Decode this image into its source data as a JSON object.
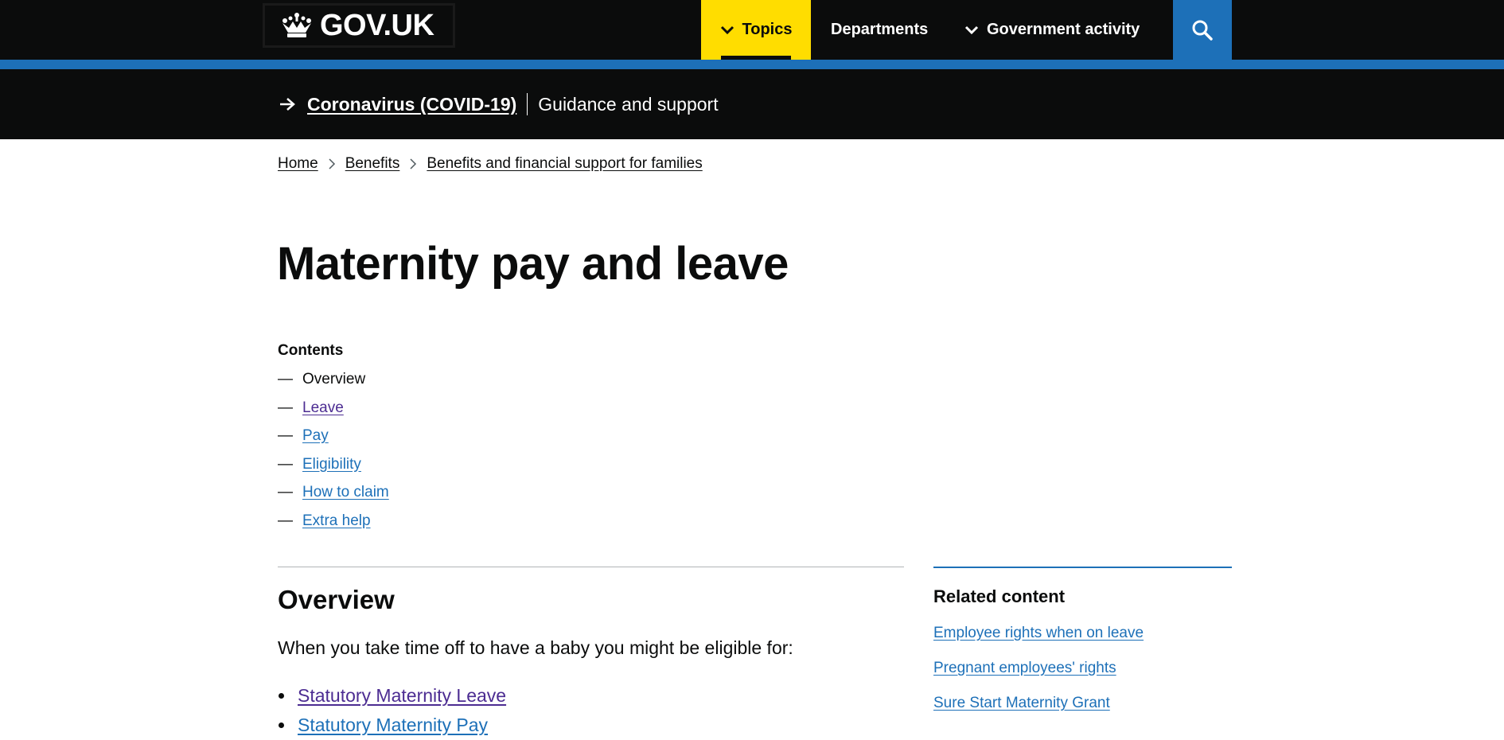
{
  "header": {
    "logo_text": "GOV.UK",
    "nav": {
      "topics": "Topics",
      "departments": "Departments",
      "government_activity": "Government activity"
    },
    "search_icon": "search-icon",
    "colors": {
      "black": "#0b0c0c",
      "yellow": "#ffdd00",
      "blue": "#1d70b8"
    }
  },
  "covid_banner": {
    "link": "Coronavirus (COVID-19)",
    "subtitle": "Guidance and support"
  },
  "breadcrumb": [
    "Home",
    "Benefits",
    "Benefits and financial support for families"
  ],
  "page": {
    "title": "Maternity pay and leave"
  },
  "contents": {
    "heading": "Contents",
    "items": [
      {
        "label": "Overview",
        "current": true
      },
      {
        "label": "Leave",
        "visited": true
      },
      {
        "label": "Pay"
      },
      {
        "label": "Eligibility"
      },
      {
        "label": "How to claim"
      },
      {
        "label": "Extra help"
      }
    ],
    "dash": "—"
  },
  "overview": {
    "heading": "Overview",
    "intro": "When you take time off to have a baby you might be eligible for:",
    "items": [
      "Statutory Maternity Leave",
      "Statutory Maternity Pay"
    ]
  },
  "related": {
    "heading": "Related content",
    "links": [
      "Employee rights when on leave",
      "Pregnant employees' rights",
      "Sure Start Maternity Grant"
    ]
  }
}
